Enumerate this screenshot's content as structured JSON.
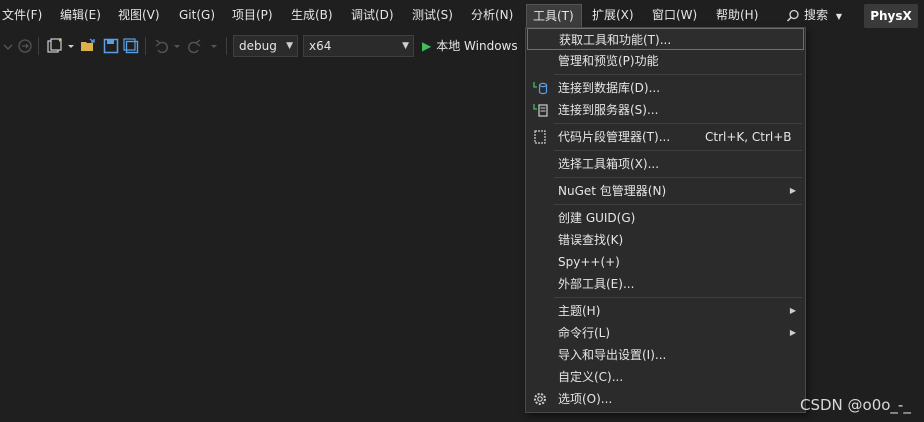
{
  "menubar": {
    "items": [
      "文件(F)",
      "编辑(E)",
      "视图(V)",
      "Git(G)",
      "项目(P)",
      "生成(B)",
      "调试(D)",
      "测试(S)",
      "分析(N)",
      "工具(T)",
      "扩展(X)",
      "窗口(W)",
      "帮助(H)"
    ],
    "search_label": "搜索",
    "app_badge": "PhysX"
  },
  "toolbar": {
    "config_value": "debug",
    "platform_value": "x64",
    "run_label": "本地 Windows"
  },
  "tools_menu": {
    "items": [
      {
        "label": "获取工具和功能(T)..."
      },
      {
        "label": "管理和预览(P)功能"
      },
      {
        "label": "连接到数据库(D)...",
        "icon": "database-connect-icon"
      },
      {
        "label": "连接到服务器(S)...",
        "icon": "server-connect-icon"
      },
      {
        "label": "代码片段管理器(T)...",
        "shortcut": "Ctrl+K, Ctrl+B",
        "icon": "snippet-manager-icon"
      },
      {
        "label": "选择工具箱项(X)..."
      },
      {
        "label": "NuGet 包管理器(N)",
        "submenu": true
      },
      {
        "label": "创建 GUID(G)"
      },
      {
        "label": "错误查找(K)"
      },
      {
        "label": "Spy++(+)"
      },
      {
        "label": "外部工具(E)..."
      },
      {
        "label": "主题(H)",
        "submenu": true
      },
      {
        "label": "命令行(L)",
        "submenu": true
      },
      {
        "label": "导入和导出设置(I)..."
      },
      {
        "label": "自定义(C)..."
      },
      {
        "label": "选项(O)...",
        "icon": "gear-icon"
      }
    ]
  },
  "watermark": "CSDN @o0o_-_",
  "colors": {
    "background": "#1f1f1f",
    "menu_bg": "#2b2b2b",
    "run_green": "#3fbf5a"
  }
}
